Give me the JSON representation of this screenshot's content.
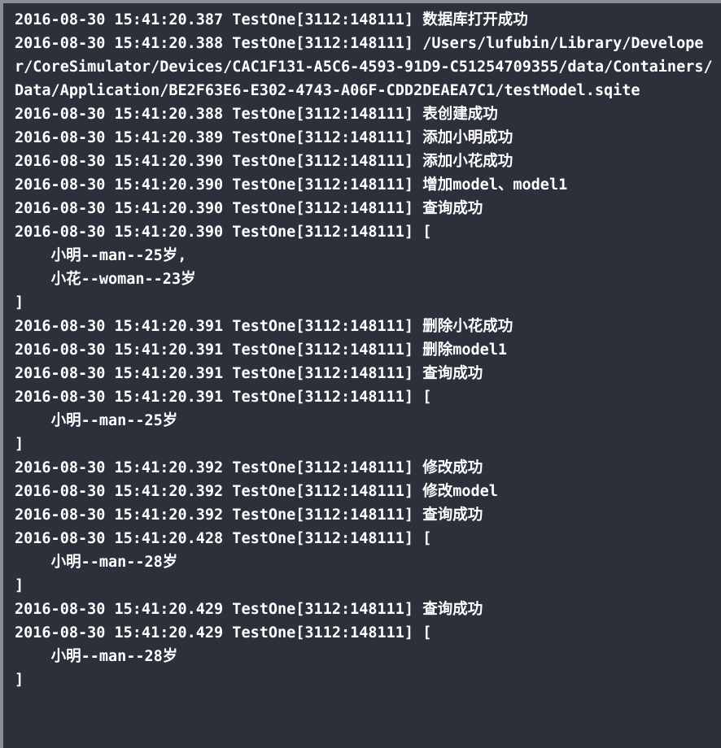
{
  "console": {
    "lines": [
      "2016-08-30 15:41:20.387 TestOne[3112:148111] 数据库打开成功",
      "2016-08-30 15:41:20.388 TestOne[3112:148111] /Users/lufubin/Library/Developer/CoreSimulator/Devices/CAC1F131-A5C6-4593-91D9-C51254709355/data/Containers/Data/Application/BE2F63E6-E302-4743-A06F-CDD2DEAEA7C1/testModel.sqite",
      "2016-08-30 15:41:20.388 TestOne[3112:148111] 表创建成功",
      "2016-08-30 15:41:20.389 TestOne[3112:148111] 添加小明成功",
      "2016-08-30 15:41:20.390 TestOne[3112:148111] 添加小花成功",
      "2016-08-30 15:41:20.390 TestOne[3112:148111] 增加model、model1",
      "2016-08-30 15:41:20.390 TestOne[3112:148111] 查询成功",
      "2016-08-30 15:41:20.390 TestOne[3112:148111] [",
      "    小明--man--25岁,",
      "    小花--woman--23岁",
      "]",
      "2016-08-30 15:41:20.391 TestOne[3112:148111] 删除小花成功",
      "2016-08-30 15:41:20.391 TestOne[3112:148111] 删除model1",
      "2016-08-30 15:41:20.391 TestOne[3112:148111] 查询成功",
      "2016-08-30 15:41:20.391 TestOne[3112:148111] [",
      "    小明--man--25岁",
      "]",
      "2016-08-30 15:41:20.392 TestOne[3112:148111] 修改成功",
      "2016-08-30 15:41:20.392 TestOne[3112:148111] 修改model",
      "2016-08-30 15:41:20.392 TestOne[3112:148111] 查询成功",
      "2016-08-30 15:41:20.428 TestOne[3112:148111] [",
      "    小明--man--28岁",
      "]",
      "2016-08-30 15:41:20.429 TestOne[3112:148111] 查询成功",
      "2016-08-30 15:41:20.429 TestOne[3112:148111] [",
      "    小明--man--28岁",
      "]"
    ]
  }
}
